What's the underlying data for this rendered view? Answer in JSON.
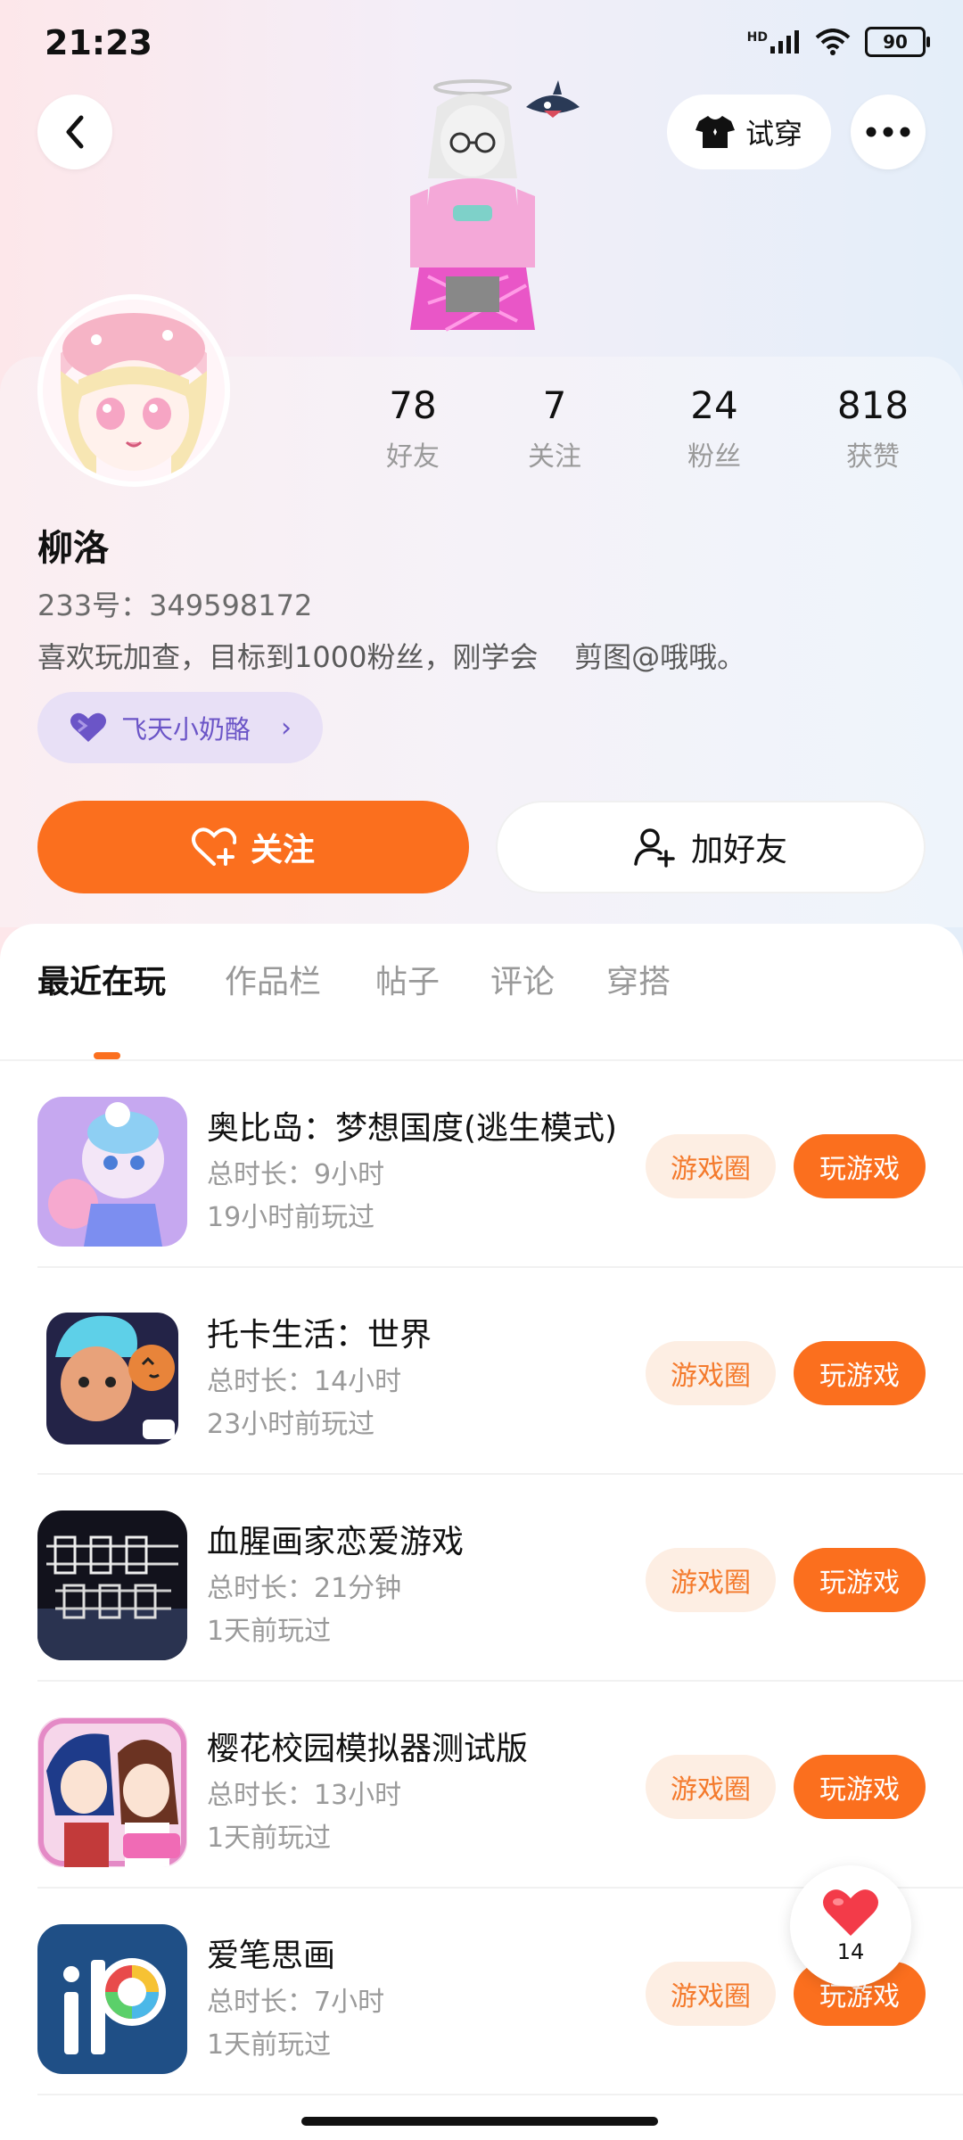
{
  "status_bar": {
    "time": "21:23",
    "network": "HD",
    "battery": "90"
  },
  "header": {
    "tryon_label": "试穿"
  },
  "profile": {
    "name": "柳洛",
    "uid": "233号：349598172",
    "bio": "喜欢玩加查，目标到1000粉丝，刚学会    剪图@哦哦。",
    "tag_label": "飞天小奶酪",
    "stats": [
      {
        "num": "78",
        "label": "好友"
      },
      {
        "num": "7",
        "label": "关注"
      },
      {
        "num": "24",
        "label": "粉丝"
      },
      {
        "num": "818",
        "label": "获赞"
      }
    ]
  },
  "actions": {
    "follow_label": "关注",
    "add_friend_label": "加好友"
  },
  "tabs": [
    "最近在玩",
    "作品栏",
    "帖子",
    "评论",
    "穿搭"
  ],
  "games": [
    {
      "title": "奥比岛：梦想国度(逃生模式)",
      "duration": "总时长：9小时",
      "last_played": "19小时前玩过",
      "icon": "obi-island-icon"
    },
    {
      "title": "托卡生活：世界",
      "duration": "总时长：14小时",
      "last_played": "23小时前玩过",
      "icon": "toca-life-icon"
    },
    {
      "title": "血腥画家恋爱游戏",
      "duration": "总时长：21分钟",
      "last_played": "1天前玩过",
      "icon": "bloody-painter-icon"
    },
    {
      "title": "樱花校园模拟器测试版",
      "duration": "总时长：13小时",
      "last_played": "1天前玩过",
      "icon": "sakura-school-icon"
    },
    {
      "title": "爱笔思画",
      "duration": "总时长：7小时",
      "last_played": "1天前玩过",
      "icon": "ibis-paint-icon"
    }
  ],
  "game_actions": {
    "circle_label": "游戏圈",
    "play_label": "玩游戏"
  },
  "floating_like": {
    "count": "14"
  },
  "colors": {
    "accent": "#fb6f1e",
    "accent_soft": "#fdeee3",
    "tag_bg": "#e8e0f6",
    "tag_text": "#6b55c7"
  }
}
